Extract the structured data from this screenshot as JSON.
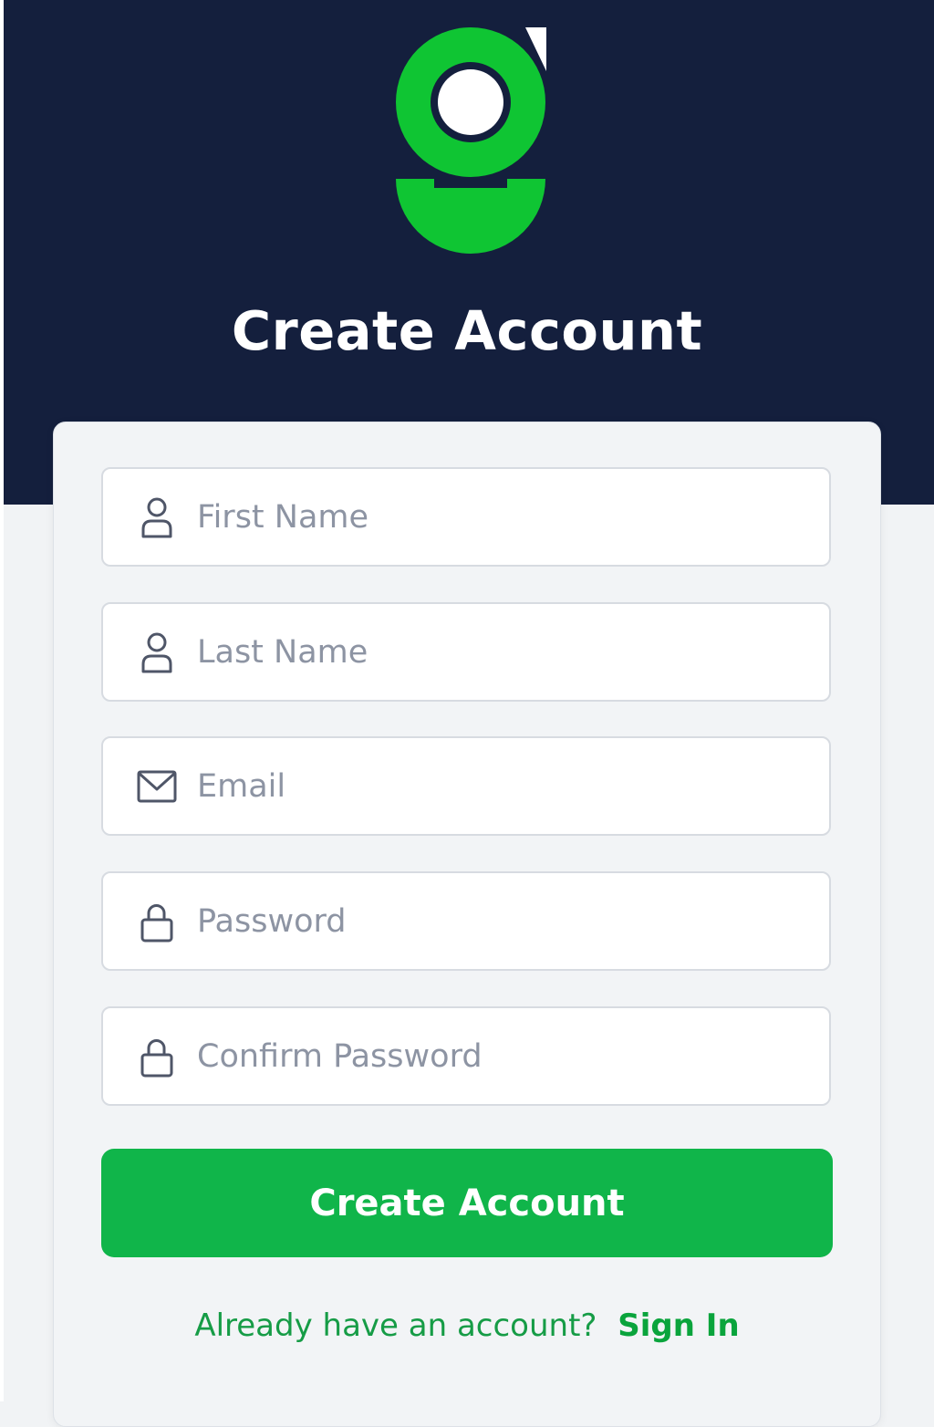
{
  "header": {
    "title": "Create Account"
  },
  "form": {
    "first_name": {
      "placeholder": "First Name",
      "value": "",
      "icon": "user-icon"
    },
    "last_name": {
      "placeholder": "Last Name",
      "value": "",
      "icon": "user-icon"
    },
    "email": {
      "placeholder": "Email",
      "value": "",
      "icon": "mail-icon"
    },
    "password": {
      "placeholder": "Password",
      "value": "",
      "icon": "lock-icon"
    },
    "confirm_password": {
      "placeholder": "Confirm Password",
      "value": "",
      "icon": "lock-icon"
    },
    "submit_label": "Create Account"
  },
  "footer": {
    "prompt": "Already have an account?",
    "link_label": "Sign In"
  },
  "colors": {
    "header_bg": "#141f3d",
    "accent_green": "#10b54a",
    "link_green": "#0aa43c",
    "logo_green": "#0fc533"
  }
}
